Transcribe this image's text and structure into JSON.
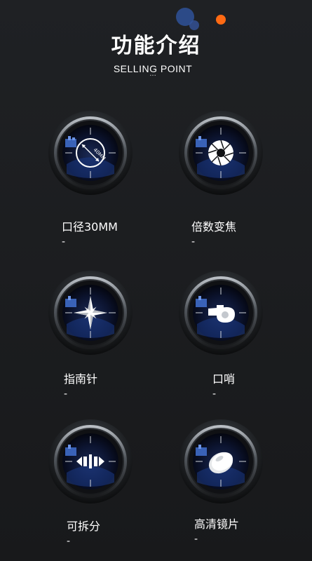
{
  "header": {
    "title": "功能介绍",
    "subtitle": "SELLING POINT",
    "dots": "···"
  },
  "lens_mark": "40MM",
  "features": [
    {
      "label": "口径30MM",
      "dash": "-",
      "icon": "aperture-40mm-icon"
    },
    {
      "label": "倍数变焦",
      "dash": "-",
      "icon": "shutter-iris-icon"
    },
    {
      "label": "指南针",
      "dash": "-",
      "icon": "compass-icon"
    },
    {
      "label": "口哨",
      "dash": "-",
      "icon": "whistle-icon"
    },
    {
      "label": "可拆分",
      "dash": "-",
      "icon": "detachable-icon"
    },
    {
      "label": "高清镜片",
      "dash": "-",
      "icon": "hd-lens-icon"
    }
  ],
  "colors": {
    "background": "#1e2023",
    "accent_orange": "#ff6a13",
    "accent_blue": "#2d4f92"
  }
}
